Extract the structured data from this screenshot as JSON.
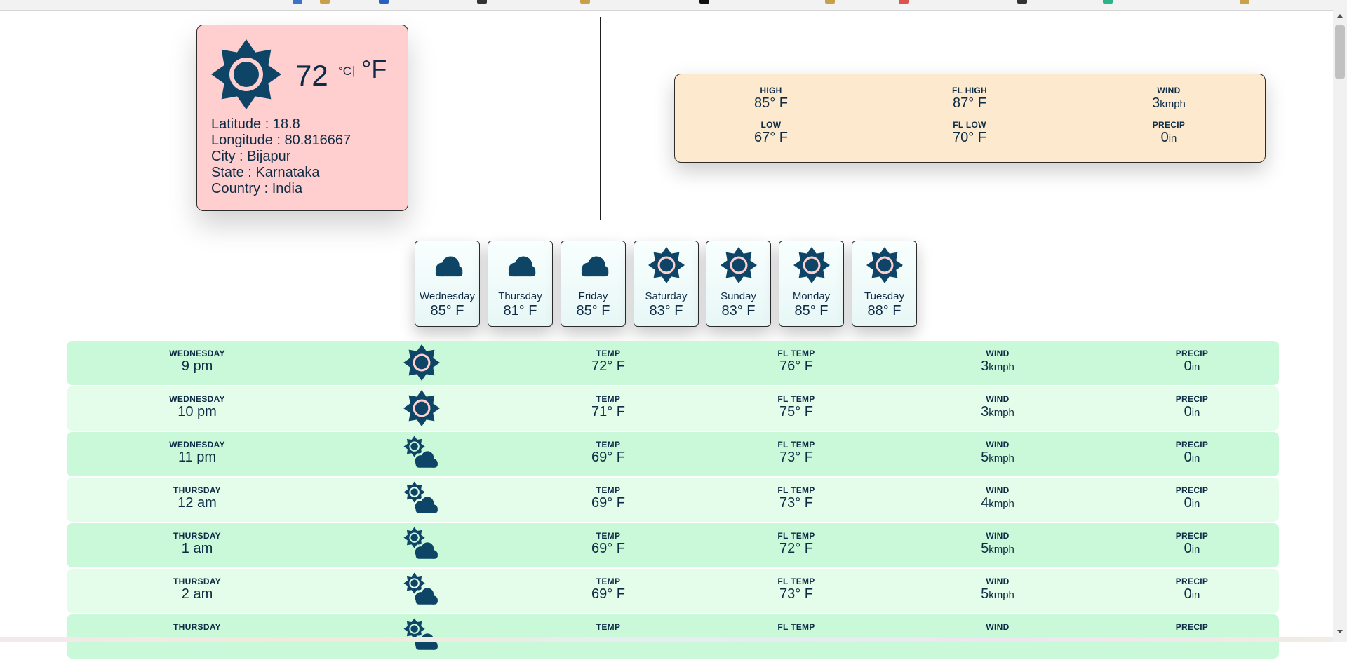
{
  "icons": {
    "sun": "sun-icon",
    "cloud": "cloud-icon",
    "partly_cloudy": "partly-cloudy-icon",
    "color_dark": "#0e4466",
    "color_light": "#ffcfcf"
  },
  "current": {
    "temperature": "72",
    "unit_c": "°C",
    "separator": "|",
    "unit_f": "°F",
    "latitude": "Latitude : 18.8",
    "longitude": "Longitude : 80.816667",
    "city": "City : Bijapur",
    "state": "State : Karnataka",
    "country": "Country : India"
  },
  "summary": {
    "high_label": "HIGH",
    "high_value": "85° F",
    "fl_high_label": "FL HIGH",
    "fl_high_value": "87° F",
    "wind_label": "WIND",
    "wind_value": "3",
    "wind_unit": "kmph",
    "low_label": "LOW",
    "low_value": "67° F",
    "fl_low_label": "FL LOW",
    "fl_low_value": "70° F",
    "precip_label": "PRECIP",
    "precip_value": "0",
    "precip_unit": "in"
  },
  "forecast": [
    {
      "day": "Wednesday",
      "temp": "85° F",
      "icon": "cloud"
    },
    {
      "day": "Thursday",
      "temp": "81° F",
      "icon": "cloud"
    },
    {
      "day": "Friday",
      "temp": "85° F",
      "icon": "cloud"
    },
    {
      "day": "Saturday",
      "temp": "83° F",
      "icon": "sun"
    },
    {
      "day": "Sunday",
      "temp": "83° F",
      "icon": "sun"
    },
    {
      "day": "Monday",
      "temp": "85° F",
      "icon": "sun"
    },
    {
      "day": "Tuesday",
      "temp": "88° F",
      "icon": "sun"
    }
  ],
  "hourly_labels": {
    "temp": "TEMP",
    "fl_temp": "FL TEMP",
    "wind": "WIND",
    "precip": "PRECIP",
    "wind_unit": "kmph",
    "precip_unit": "in"
  },
  "hourly": [
    {
      "day": "WEDNESDAY",
      "time": "9 pm",
      "icon": "sun",
      "temp": "72° F",
      "fl_temp": "76° F",
      "wind": "3",
      "precip": "0"
    },
    {
      "day": "WEDNESDAY",
      "time": "10 pm",
      "icon": "sun",
      "temp": "71° F",
      "fl_temp": "75° F",
      "wind": "3",
      "precip": "0"
    },
    {
      "day": "WEDNESDAY",
      "time": "11 pm",
      "icon": "partly_cloudy",
      "temp": "69° F",
      "fl_temp": "73° F",
      "wind": "5",
      "precip": "0"
    },
    {
      "day": "THURSDAY",
      "time": "12 am",
      "icon": "partly_cloudy",
      "temp": "69° F",
      "fl_temp": "73° F",
      "wind": "4",
      "precip": "0"
    },
    {
      "day": "THURSDAY",
      "time": "1 am",
      "icon": "partly_cloudy",
      "temp": "69° F",
      "fl_temp": "72° F",
      "wind": "5",
      "precip": "0"
    },
    {
      "day": "THURSDAY",
      "time": "2 am",
      "icon": "partly_cloudy",
      "temp": "69° F",
      "fl_temp": "73° F",
      "wind": "5",
      "precip": "0"
    },
    {
      "day": "THURSDAY",
      "time": "",
      "icon": "partly_cloudy",
      "temp": "",
      "fl_temp": "",
      "wind": "",
      "precip": ""
    }
  ]
}
